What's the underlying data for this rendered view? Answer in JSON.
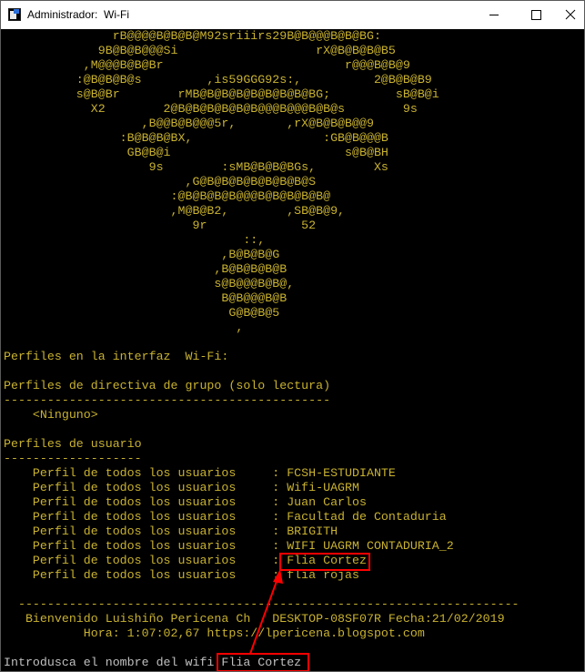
{
  "window": {
    "title": "Administrador:  Wi-Fi",
    "controls": {
      "minimize": "—",
      "maximize": "☐",
      "close": "✕"
    },
    "app_icon": "console-app-icon"
  },
  "ascii_art": [
    "               rB@@@@B@B@B@M92sriiirs29B@B@@@B@B@BG:",
    "             9B@B@B@@@Si                   rX@B@B@B@B5",
    "           ,M@@@B@B@Br                         r@@@B@B@9",
    "          :@B@B@B@s         ,is59GGG92s:,          2@B@B@B9",
    "          s@B@Br        rMB@B@B@B@B@B@B@B@BG;         sB@B@i",
    "            X2        2@B@B@B@B@B@B@@@B@@@B@B@s        9s",
    "                   ,B@@B@B@@@5r,       ,rX@B@B@B@@9",
    "                :B@B@B@BX,                  :GB@B@@@B",
    "                 GB@B@i                        s@B@BH",
    "                    9s        :sMB@B@B@BGs,        Xs",
    "                         ,G@B@B@B@B@B@B@B@S",
    "                       :@B@B@B@B@@@B@B@B@B@B@",
    "                       ,M@B@B2,        ,SB@B@9,",
    "                          9r             52",
    "                                 ::,",
    "                              ,B@B@B@G",
    "                             ,B@B@B@B@B",
    "                             s@B@@@B@B@,",
    "                              B@B@@@B@B",
    "                               G@B@B@5",
    "                                ,"
  ],
  "section_interface": "Perfiles en la interfaz  Wi-Fi:",
  "section_group": "Perfiles de directiva de grupo (solo lectura)",
  "separator_group": "---------------------------------------------",
  "group_none": "    <Ninguno>",
  "section_user": "Perfiles de usuario",
  "separator_user": "-------------------",
  "profile_label": "    Perfil de todos los usuarios     : ",
  "profiles": [
    "FCSH-ESTUDIANTE",
    "Wifi-UAGRM",
    "Juan Carlos",
    "Facultad de Contaduria",
    "BRIGITH",
    "WIFI UAGRM CONTADURIA_2",
    "Flia Cortez",
    "flia rojas"
  ],
  "footer": {
    "separator": "  ---------------------------------------------------------------------",
    "line1": "   Bienvenido Luishiño Pericena Ch   DESKTOP-08SF07R Fecha:21/02/2019",
    "line2": "           Hora: 1:07:02,67 https://lpericena.blogspot.com"
  },
  "prompt": {
    "label": "Introdusca el nombre del wifi ",
    "value": "Flia Cortez"
  },
  "highlight_color": "#ff0000"
}
